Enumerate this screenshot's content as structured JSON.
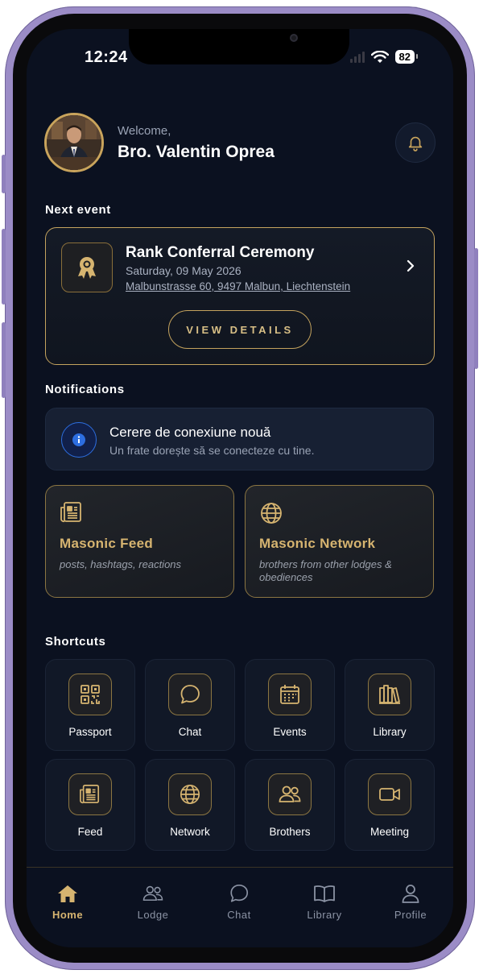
{
  "status_bar": {
    "time": "12:24",
    "battery": "82"
  },
  "header": {
    "welcome": "Welcome,",
    "user_name": "Bro. Valentin Oprea"
  },
  "next_event": {
    "section_title": "Next event",
    "title": "Rank Conferral Ceremony",
    "date": "Saturday, 09 May 2026",
    "address": "Malbunstrasse 60, 9497 Malbun, Liechtenstein",
    "button_label": "VIEW DETAILS"
  },
  "notifications": {
    "section_title": "Notifications",
    "items": [
      {
        "title": "Cerere de conexiune nouă",
        "text": "Un frate dorește să se conecteze cu tine."
      }
    ]
  },
  "features": [
    {
      "title": "Masonic Feed",
      "subtitle": "posts, hashtags, reactions",
      "icon": "newspaper-icon"
    },
    {
      "title": "Masonic Network",
      "subtitle": "brothers from other lodges & obediences",
      "icon": "globe-icon"
    }
  ],
  "shortcuts": {
    "section_title": "Shortcuts",
    "items": [
      {
        "label": "Passport",
        "icon": "qr-code-icon"
      },
      {
        "label": "Chat",
        "icon": "chat-bubble-icon"
      },
      {
        "label": "Events",
        "icon": "calendar-icon"
      },
      {
        "label": "Library",
        "icon": "books-icon"
      },
      {
        "label": "Feed",
        "icon": "newspaper-icon"
      },
      {
        "label": "Network",
        "icon": "globe-icon"
      },
      {
        "label": "Brothers",
        "icon": "users-icon"
      },
      {
        "label": "Meeting",
        "icon": "video-camera-icon"
      }
    ]
  },
  "tabbar": {
    "items": [
      {
        "label": "Home",
        "icon": "home-icon",
        "active": true
      },
      {
        "label": "Lodge",
        "icon": "group-icon",
        "active": false
      },
      {
        "label": "Chat",
        "icon": "chat-bubble-icon",
        "active": false
      },
      {
        "label": "Library",
        "icon": "book-open-icon",
        "active": false
      },
      {
        "label": "Profile",
        "icon": "person-icon",
        "active": false
      }
    ]
  },
  "colors": {
    "accent_gold": "#c9a45c",
    "background": "#0b1120",
    "info_blue": "#2d6ee0"
  }
}
